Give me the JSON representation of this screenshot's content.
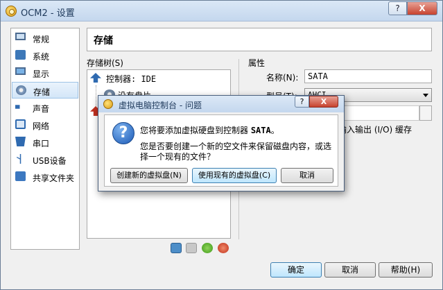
{
  "window": {
    "title": "OCM2 - 设置",
    "help_btn": "?",
    "close_btn": "X"
  },
  "sidebar": {
    "items": [
      {
        "label": "常规",
        "icon": "monitor-icon"
      },
      {
        "label": "系统",
        "icon": "chip-icon"
      },
      {
        "label": "显示",
        "icon": "display-icon"
      },
      {
        "label": "存储",
        "icon": "disk-icon",
        "selected": true
      },
      {
        "label": "声音",
        "icon": "speaker-icon"
      },
      {
        "label": "网络",
        "icon": "network-icon"
      },
      {
        "label": "串口",
        "icon": "serial-port-icon"
      },
      {
        "label": "USB设备",
        "icon": "usb-icon"
      },
      {
        "label": "共享文件夹",
        "icon": "folder-icon"
      }
    ]
  },
  "page": {
    "title": "存储"
  },
  "tree": {
    "label": "存储树(S)",
    "controller_ide": "控制器: IDE",
    "empty_drive": "没有盘片"
  },
  "attributes": {
    "label": "属性",
    "name_label": "名称(N):",
    "name_value": "SATA",
    "type_label": "型号(T):",
    "type_value": "AHCI",
    "io_cache": "机输入输出 (I/O) 缓存"
  },
  "dialog": {
    "title": "虚拟电脑控制台 - 问题",
    "help_btn": "?",
    "close_btn": "X",
    "msg_prefix": "您将要添加虚拟硬盘到控制器 ",
    "msg_controller": "SATA",
    "msg_suffix": "。",
    "msg2": "您是否要创建一个新的空文件来保留磁盘内容，或选择一个现有的文件？",
    "btn_new": "创建新的虚拟盘(N)",
    "btn_existing": "使用现有的虚拟盘(C)",
    "btn_cancel": "取消"
  },
  "buttons": {
    "ok": "确定",
    "cancel": "取消",
    "help": "帮助(H)"
  }
}
